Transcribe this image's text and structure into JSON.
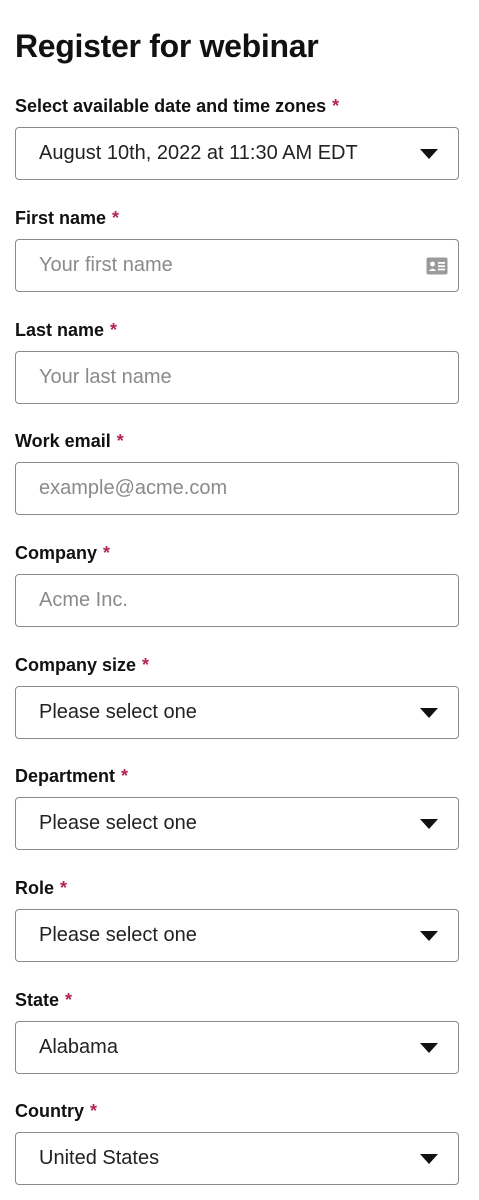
{
  "form": {
    "title": "Register for webinar",
    "required_mark": "*",
    "fields": [
      {
        "label": "Select available date and time zones",
        "type": "select",
        "value": "August 10th, 2022 at 11:30 AM EDT"
      },
      {
        "label": "First name",
        "type": "text",
        "placeholder": "Your first name",
        "icon": "contact-card-icon"
      },
      {
        "label": "Last name",
        "type": "text",
        "placeholder": "Your last name"
      },
      {
        "label": "Work email",
        "type": "text",
        "placeholder": "example@acme.com"
      },
      {
        "label": "Company",
        "type": "text",
        "placeholder": "Acme Inc."
      },
      {
        "label": "Company size",
        "type": "select",
        "value": "Please select one"
      },
      {
        "label": "Department",
        "type": "select",
        "value": "Please select one"
      },
      {
        "label": "Role",
        "type": "select",
        "value": "Please select one"
      },
      {
        "label": "State",
        "type": "select",
        "value": "Alabama"
      },
      {
        "label": "Country",
        "type": "select",
        "value": "United States"
      }
    ]
  },
  "colors": {
    "required": "#b3225a",
    "border": "#8a8a8a",
    "placeholder": "#8a8a8a",
    "text": "#111111"
  }
}
